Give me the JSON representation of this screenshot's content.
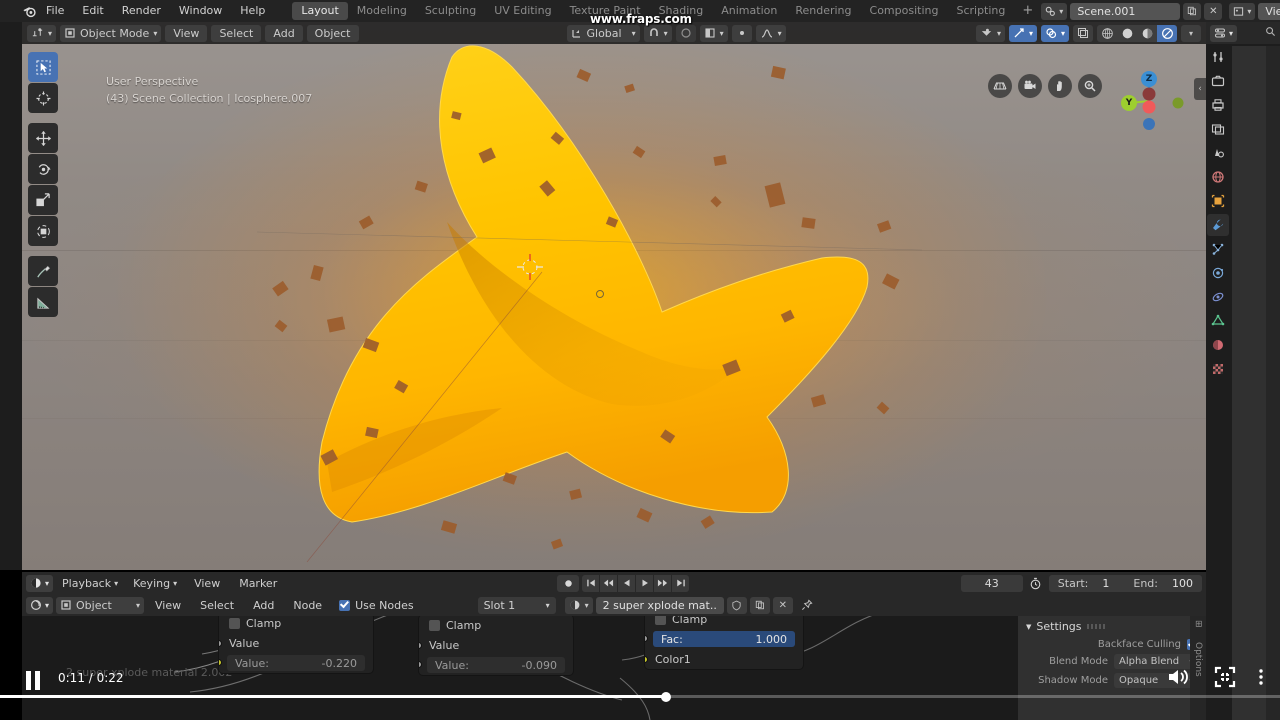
{
  "app": {
    "watermark": "www.fraps.com"
  },
  "topbar": {
    "logo_icon": "blender-logo-icon",
    "menus": [
      "File",
      "Edit",
      "Render",
      "Window",
      "Help"
    ],
    "workspace_tabs": [
      {
        "label": "Layout",
        "active": true
      },
      {
        "label": "Modeling",
        "active": false
      },
      {
        "label": "Sculpting",
        "active": false
      },
      {
        "label": "UV Editing",
        "active": false
      },
      {
        "label": "Texture Paint",
        "active": false
      },
      {
        "label": "Shading",
        "active": false
      },
      {
        "label": "Animation",
        "active": false
      },
      {
        "label": "Rendering",
        "active": false
      },
      {
        "label": "Compositing",
        "active": false
      },
      {
        "label": "Scripting",
        "active": false
      }
    ],
    "add_workspace_label": "+",
    "scene_name": "Scene.001",
    "scene_icon": "scene-icon",
    "view_layer_name": "View Layer",
    "view_layer_icon": "view-layer-icon",
    "new_scene_icon": "duplicate-icon",
    "remove_scene_icon": "close-icon",
    "new_layer_icon": "duplicate-icon",
    "remove_layer_icon": "close-icon"
  },
  "viewport": {
    "editor_type_icon": "editor-type-icon",
    "mode": "Object Mode",
    "mode_icon": "object-mode-icon",
    "menus": [
      "View",
      "Select",
      "Add",
      "Object"
    ],
    "transform_orientation": "Global",
    "transform_icon": "orientation-icon",
    "snap_icon": "magnet-icon",
    "proportional_icon": "proportional-edit-icon",
    "falloff_icon": "falloff-icon",
    "overlay_icon": "overlays-icon",
    "xray_icon": "xray-icon",
    "gizmo_icon": "gizmo-icon",
    "shading_modes": [
      {
        "name": "wireframe-shading",
        "active": false
      },
      {
        "name": "solid-shading",
        "active": false
      },
      {
        "name": "material-preview-shading",
        "active": false
      },
      {
        "name": "rendered-shading",
        "active": true
      }
    ],
    "overlay_text_line1": "User Perspective",
    "overlay_text_line2": "(43) Scene Collection | Icosphere.007",
    "tools": [
      {
        "name": "tweak-select-box-tool",
        "icon": "cursor-box-icon",
        "active": true
      },
      {
        "name": "cursor-tool",
        "icon": "3d-cursor-icon",
        "active": false
      },
      {
        "name": "move-tool",
        "icon": "move-icon",
        "active": false
      },
      {
        "name": "rotate-tool",
        "icon": "rotate-icon",
        "active": false
      },
      {
        "name": "scale-tool",
        "icon": "scale-icon",
        "active": false
      },
      {
        "name": "transform-tool",
        "icon": "transform-icon",
        "active": false
      },
      {
        "name": "annotate-tool",
        "icon": "pencil-icon",
        "active": false
      },
      {
        "name": "measure-tool",
        "icon": "ruler-icon",
        "active": false
      }
    ],
    "nav_buttons": [
      {
        "name": "toggle-orthographic-button",
        "icon": "grid-icon"
      },
      {
        "name": "camera-view-button",
        "icon": "camera-icon"
      },
      {
        "name": "pan-view-button",
        "icon": "hand-icon"
      },
      {
        "name": "zoom-view-button",
        "icon": "magnifier-icon"
      }
    ],
    "gizmo_axes": [
      {
        "label": "Z",
        "color": "#3b8fd4"
      },
      {
        "label": "Y",
        "color": "#9dcf2f"
      },
      {
        "label": "X",
        "color": "#f05a5a"
      }
    ]
  },
  "timeline": {
    "editor_type_icon": "timeline-editor-icon",
    "menus": [
      "Playback",
      "Keying",
      "View",
      "Marker"
    ],
    "record_icon": "record-icon",
    "playback_buttons": [
      {
        "name": "jump-to-start-button",
        "icon": "jump-start-icon"
      },
      {
        "name": "previous-keyframe-button",
        "icon": "prev-keyframe-icon"
      },
      {
        "name": "play-reverse-button",
        "icon": "play-reverse-icon"
      },
      {
        "name": "play-button",
        "icon": "play-icon"
      },
      {
        "name": "next-keyframe-button",
        "icon": "next-keyframe-icon"
      },
      {
        "name": "jump-to-end-button",
        "icon": "jump-end-icon"
      }
    ],
    "current_frame": "43",
    "sync_icon": "stopwatch-icon",
    "start_label": "Start:",
    "start_value": "1",
    "end_label": "End:",
    "end_value": "100"
  },
  "shader_editor": {
    "editor_type_icon": "shader-editor-icon",
    "shader_type": "Object",
    "shader_type_icon": "object-icon",
    "menus": [
      "View",
      "Select",
      "Add",
      "Node"
    ],
    "use_nodes_label": "Use Nodes",
    "use_nodes_checked": true,
    "slot_label": "Slot 1",
    "material_icon": "material-sphere-icon",
    "material_name": "2 super xplode mat..",
    "fake_user_icon": "shield-icon",
    "new_material_icon": "duplicate-icon",
    "unlink_icon": "close-icon",
    "pin_icon": "pin-icon",
    "background_node_label": "2 super xplode material 2.002",
    "nodes": [
      {
        "name": "math-node-1",
        "clamp_label": "Clamp",
        "clamp_checked": false,
        "value_socket_label": "Value",
        "value_field_label": "Value:",
        "value_field_value": "-0.220"
      },
      {
        "name": "math-node-2",
        "clamp_label": "Clamp",
        "clamp_checked": false,
        "value_socket_label": "Value",
        "value_field_label": "Value:",
        "value_field_value": "-0.090"
      },
      {
        "name": "mix-rgb-node",
        "clamp_label": "Clamp",
        "clamp_checked": false,
        "fac_label": "Fac:",
        "fac_value": "1.000",
        "color1_label": "Color1"
      }
    ]
  },
  "properties": {
    "editor_type_icon": "properties-editor-icon",
    "tabs": [
      {
        "name": "tool-tab",
        "icon": "tool-icon",
        "active": false,
        "color": "#c8c8c8"
      },
      {
        "name": "render-tab",
        "icon": "camera-back-icon",
        "active": false,
        "color": "#c8c8c8"
      },
      {
        "name": "output-tab",
        "icon": "printer-icon",
        "active": false,
        "color": "#c8c8c8"
      },
      {
        "name": "view-layer-tab",
        "icon": "images-icon",
        "active": false,
        "color": "#c8c8c8"
      },
      {
        "name": "scene-tab",
        "icon": "scene-cone-icon",
        "active": false,
        "color": "#c8c8c8"
      },
      {
        "name": "world-tab",
        "icon": "world-globe-icon",
        "active": false,
        "color": "#d07878"
      },
      {
        "name": "object-tab",
        "icon": "object-square-icon",
        "active": false,
        "color": "#e8a33d"
      },
      {
        "name": "modifier-tab",
        "icon": "wrench-icon",
        "active": true,
        "color": "#5b9ad6"
      },
      {
        "name": "particles-tab",
        "icon": "particles-icon",
        "active": false,
        "color": "#8ab4dd"
      },
      {
        "name": "physics-tab",
        "icon": "physics-orbit-icon",
        "active": false,
        "color": "#7aa8d8"
      },
      {
        "name": "constraints-tab",
        "icon": "constraint-icon",
        "active": false,
        "color": "#7b8fd0"
      },
      {
        "name": "data-tab",
        "icon": "mesh-data-icon",
        "active": false,
        "color": "#5bc48f"
      },
      {
        "name": "material-tab",
        "icon": "material-sphere-icon",
        "active": false,
        "color": "#d06a72"
      },
      {
        "name": "texture-tab",
        "icon": "checker-texture-icon",
        "active": false,
        "color": "#c36a6a"
      }
    ],
    "settings": {
      "title": "Settings",
      "expand_icon": "triangle-down-icon",
      "backface_culling_label": "Backface Culling",
      "backface_culling_checked": true,
      "blend_mode_label": "Blend Mode",
      "blend_mode_value": "Alpha Blend",
      "shadow_mode_label": "Shadow Mode",
      "shadow_mode_value": "Opaque"
    }
  },
  "player": {
    "pause_icon": "pause-icon",
    "time_display": "0:11 / 0:22",
    "progress_percent": 52,
    "volume_icon": "volume-icon",
    "fullscreen_icon": "fullscreen-icon",
    "more_icon": "more-vertical-icon"
  }
}
